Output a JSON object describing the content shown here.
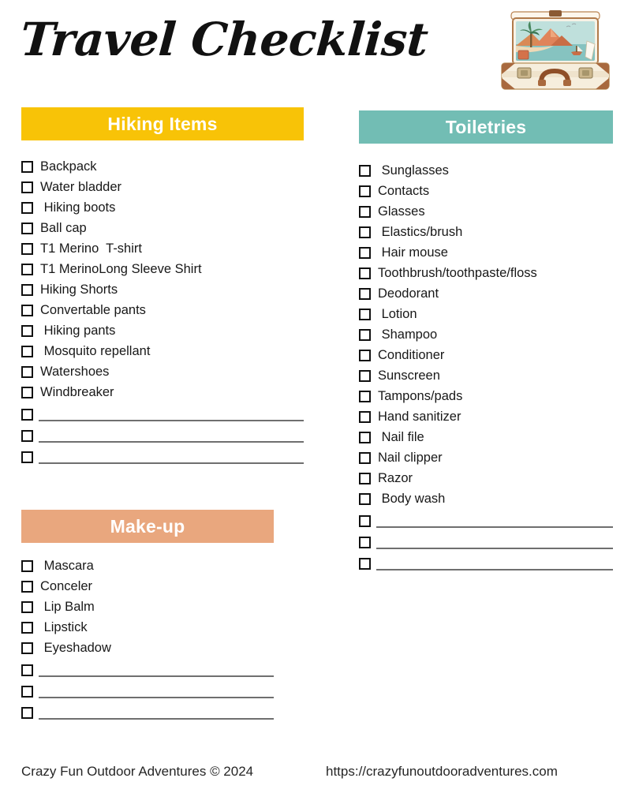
{
  "page": {
    "title": "Travel Checklist",
    "illustration": "open-suitcase-tropical-scene"
  },
  "colors": {
    "hiking_header_bg": "#F8C307",
    "toiletries_header_bg": "#72BDB4",
    "makeup_header_bg": "#E9A77E",
    "header_text": "#FFFFFF",
    "body_text": "#181818",
    "rule_line": "#6F6F6F"
  },
  "sections": {
    "hiking": {
      "header": "Hiking Items",
      "items": [
        "Backpack",
        "Water bladder",
        " Hiking boots",
        "Ball cap",
        "T1 Merino  T-shirt",
        "T1 MerinoLong Sleeve Shirt",
        "Hiking Shorts",
        "Convertable pants",
        " Hiking pants",
        " Mosquito repellant",
        "Watershoes",
        "Windbreaker"
      ],
      "blank_lines": 3
    },
    "makeup": {
      "header": "Make-up",
      "items": [
        " Mascara",
        "Conceler",
        " Lip Balm",
        " Lipstick",
        " Eyeshadow"
      ],
      "blank_lines": 3
    },
    "toiletries": {
      "header": "Toiletries",
      "items": [
        " Sunglasses",
        "Contacts",
        "Glasses",
        " Elastics/brush",
        " Hair mouse",
        "Toothbrush/toothpaste/floss",
        "Deodorant",
        " Lotion",
        " Shampoo",
        "Conditioner",
        "Sunscreen",
        "Tampons/pads",
        "Hand sanitizer",
        " Nail file",
        "Nail clipper",
        "Razor",
        " Body wash"
      ],
      "blank_lines": 3
    }
  },
  "footer": {
    "copyright": "Crazy Fun Outdoor Adventures © 2024",
    "url": "https://crazyfunoutdooradventures.com"
  }
}
